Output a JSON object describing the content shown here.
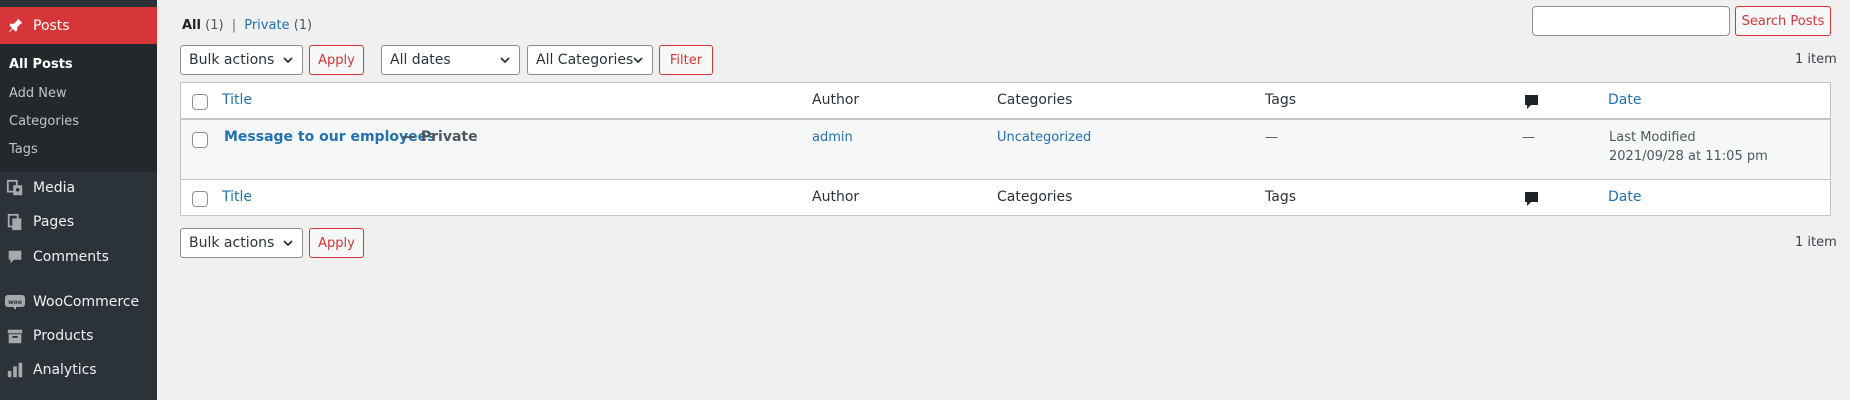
{
  "sidebar": {
    "active": {
      "label": "Posts",
      "icon": "pushpin-icon"
    },
    "submenu": [
      {
        "label": "All Posts",
        "current": true
      },
      {
        "label": "Add New"
      },
      {
        "label": "Categories"
      },
      {
        "label": "Tags"
      }
    ],
    "items": [
      {
        "label": "Media",
        "icon": "media-icon"
      },
      {
        "label": "Pages",
        "icon": "pages-icon"
      },
      {
        "label": "Comments",
        "icon": "comment-icon"
      },
      {
        "label": "WooCommerce",
        "icon": "woocommerce-icon"
      },
      {
        "label": "Products",
        "icon": "archive-box-icon"
      },
      {
        "label": "Analytics",
        "icon": "bar-chart-icon"
      }
    ]
  },
  "views": {
    "all_label": "All",
    "all_count": "(1)",
    "separator": "|",
    "private_label": "Private",
    "private_count": "(1)"
  },
  "search": {
    "value": "",
    "button": "Search Posts"
  },
  "top_nav": {
    "bulk_actions": "Bulk actions",
    "apply": "Apply",
    "dates": "All dates",
    "categories": "All Categories",
    "filter": "Filter",
    "count": "1 item"
  },
  "bottom_nav": {
    "bulk_actions": "Bulk actions",
    "apply": "Apply",
    "count": "1 item"
  },
  "columns": {
    "title": "Title",
    "author": "Author",
    "categories": "Categories",
    "tags": "Tags",
    "comments_icon": "comment-bubble-icon",
    "date": "Date"
  },
  "rows": [
    {
      "title": "Message to our employees",
      "state": "— Private",
      "author": "admin",
      "categories": "Uncategorized",
      "tags": "—",
      "comments": "—",
      "date_status": "Last Modified",
      "date_value": "2021/09/28 at 11:05 pm"
    }
  ],
  "colors": {
    "accent": "#d63638",
    "link": "#2271b1",
    "sidebar_bg": "#2c3338"
  }
}
